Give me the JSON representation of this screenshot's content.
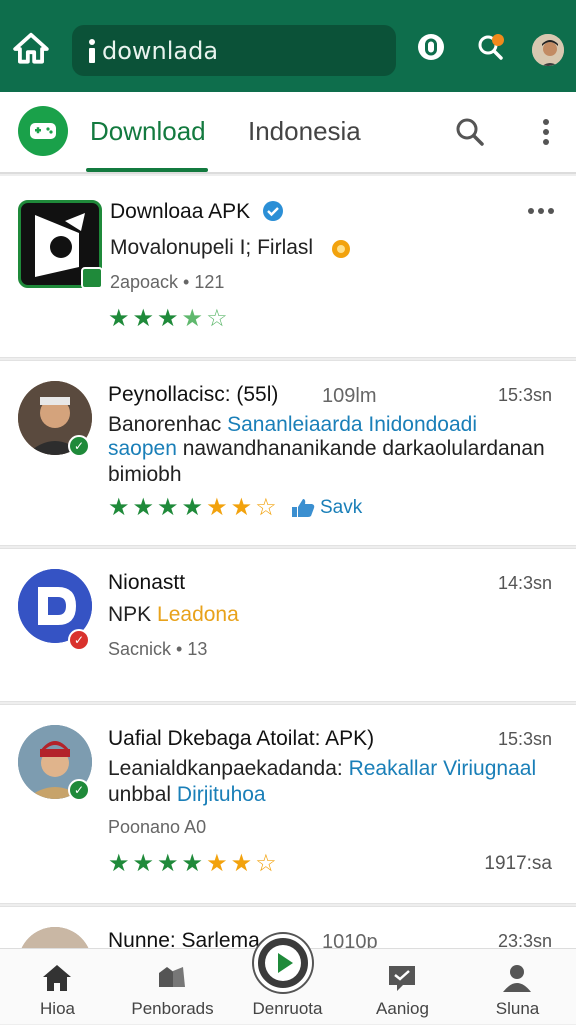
{
  "topbar": {
    "url_text": "downlada",
    "icons": [
      "home-icon",
      "info-icon",
      "shield-icon",
      "search-notification-icon",
      "profile-avatar"
    ],
    "accent": "#0e6e4c"
  },
  "tabs": {
    "active": "Download",
    "inactive": "Indonesia",
    "accent": "#137a3f"
  },
  "app_card": {
    "title": "Downloaa APK",
    "subtitle": "Movalonupeli I; Firlasl",
    "meta": "2apoack • 121",
    "rating_stars": 4.5
  },
  "posts": [
    {
      "author": "Peynollacisc: (55l)",
      "count": "109lm",
      "time": "15:3sn",
      "line1_a": "Banorenhac",
      "line1_b": "Sananleiaarda",
      "line1_c": "Inidondoadi",
      "line2_a": "saopen",
      "line2_b": "nawandhananikande darkaolulardanan",
      "line3": "bimiobh",
      "rating_stars": 5.5,
      "tag": "Savk"
    },
    {
      "author": "Nionastt",
      "time": "14:3sn",
      "line1_a": "NPK",
      "line1_b": "Leadona",
      "meta": "Sacnick • 13"
    },
    {
      "author": "Uafial Dkebaga Atoilat: APK)",
      "time": "15:3sn",
      "line1_a": "Leanialdkanpaekadanda:",
      "line1_b": "Reakallar Viriugnaal",
      "line2_a": "unbbal",
      "line2_b": "Dirjituhoa",
      "meta": "Poonano A0",
      "rating_stars": 6.5,
      "footer_time": "1917:sa"
    },
    {
      "author": "Nunne: Sarlema",
      "count": "1010p",
      "time": "23:3sn"
    }
  ],
  "bottom_nav": [
    {
      "label": "Hioa",
      "icon": "home-icon"
    },
    {
      "label": "Penborads",
      "icon": "community-icon"
    },
    {
      "label": "Denruota",
      "icon": "play-icon"
    },
    {
      "label": "Aaniog",
      "icon": "message-icon"
    },
    {
      "label": "Sluna",
      "icon": "profile-icon"
    }
  ]
}
